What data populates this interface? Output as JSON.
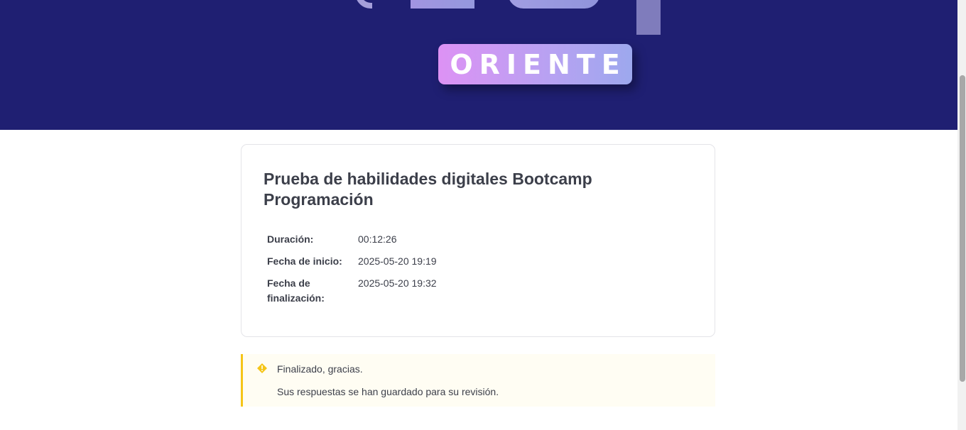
{
  "banner": {
    "badge_text": "ORIENTE",
    "background_color": "#1f1f72"
  },
  "test": {
    "title": "Prueba de habilidades digitales Bootcamp Programación",
    "details": [
      {
        "label": "Duración:",
        "value": "00:12:26"
      },
      {
        "label": "Fecha de inicio:",
        "value": "2025-05-20 19:19"
      },
      {
        "label": "Fecha de finalización:",
        "value": "2025-05-20 19:32"
      }
    ]
  },
  "notice": {
    "icon": "warning-icon",
    "accent_color": "#f5c518",
    "line1": "Finalizado, gracias.",
    "line2": "Sus respuestas se han guardado para su revisión."
  }
}
